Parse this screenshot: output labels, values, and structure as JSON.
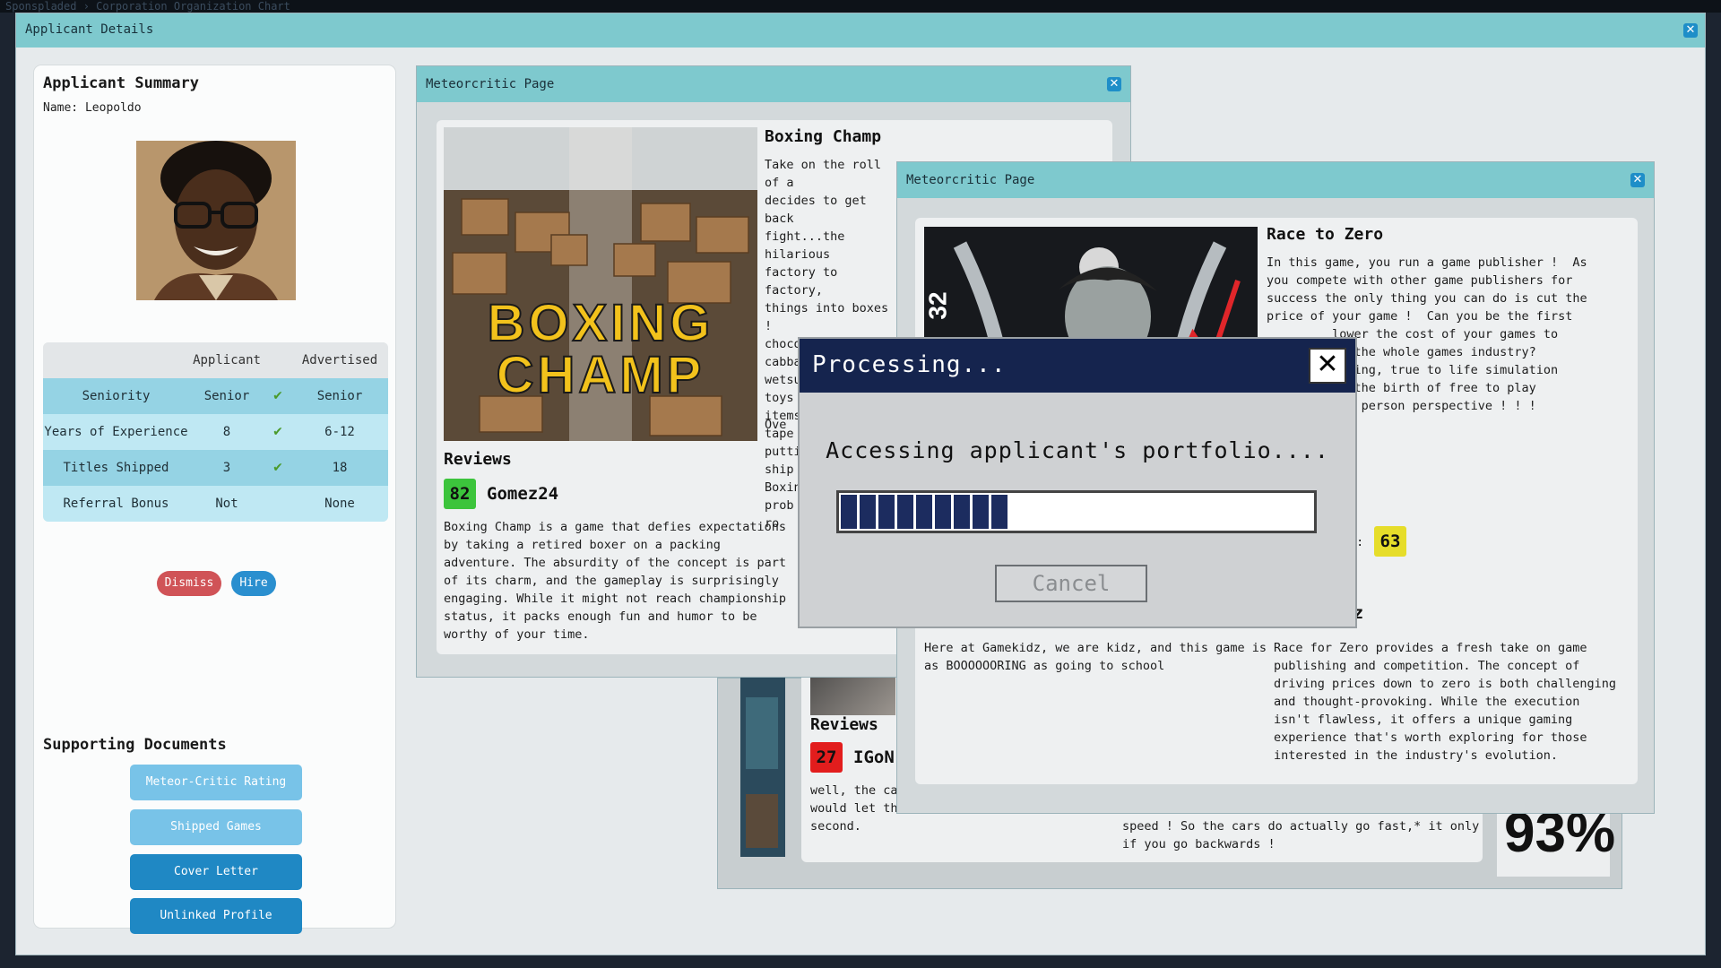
{
  "top_strip": {
    "text": "Sponspladed › Corporation Organization Chart"
  },
  "main_window": {
    "title": "Applicant Details"
  },
  "applicant": {
    "summary_title": "Applicant Summary",
    "name_line": "Name: Leopoldo",
    "table": {
      "headers": [
        "",
        "Applicant",
        "",
        "Advertised"
      ],
      "rows": [
        {
          "label": "Seniority",
          "applicant": "Senior",
          "match": "✔",
          "advertised": "Senior"
        },
        {
          "label": "Years of Experience",
          "applicant": "8",
          "match": "✔",
          "advertised": "6-12"
        },
        {
          "label": "Titles Shipped",
          "applicant": "3",
          "match": "✔",
          "advertised": "18"
        },
        {
          "label": "Referral Bonus",
          "applicant": "Not Referred",
          "match": "",
          "advertised": "None"
        }
      ]
    },
    "dismiss_label": "Dismiss",
    "hire_label": "Hire"
  },
  "supporting_docs": {
    "title": "Supporting Documents",
    "buttons": [
      "Meteor-Critic Rating",
      "Shipped Games",
      "Cover Letter",
      "Unlinked Profile"
    ]
  },
  "meteocritic_1": {
    "title": "Meteorcritic Page",
    "game_title": "Boxing Champ",
    "cover_text": "BOXING\nCHAMP",
    "description": "Take on the roll of a\ndecides to get back\nfight...the hilarious\nfactory to factory,\nthings into boxes !\nchocolates, cabbage\nwetsuits, and toys !\nitems and then tape\nputting on the ship\nBoxing Champ is prob\nro",
    "overall_partial": "Ove",
    "reviews_heading": "Reviews",
    "review": {
      "score": "82",
      "reviewer": "Gomez24",
      "text": "Boxing Champ is a game that defies expectations\nby taking a retired boxer on a packing\nadventure. The absurdity of the concept is part\nof its charm, and the gameplay is surprisingly\nengaging. While it might not reach championship\nstatus, it packs enough fun and humor to be\nworthy of your time."
    }
  },
  "meteocritic_2": {
    "title": "Meteorcritic Page",
    "game_title": "Race to Zero",
    "cover_number": "32",
    "description": "In this game, you run a game publisher !  As\nyou compete with other game publishers for\nsuccess the only thing you can do is cut the\nprice of your game !  Can you be the first\n         lower the cost of your games to\n       troy the whole games industry?\n       exciting, true to life simulation\n       ence the birth of free to play\n       first person perspective ! ! !",
    "rating_partial": "g:",
    "rating_score": "63",
    "reviewer_partial": "oGomerz",
    "review_left": "Here at Gamekidz, we are kidz, and this game is\nas BOOOOOORING as going to school",
    "review_right": "Race for Zero provides a fresh take on game\npublishing and competition. The concept of\ndriving prices down to zero is both challenging\nand thought-provoking. While the execution\nisn't flawless, it offers a unique gaming\nexperience that's worth exploring for those\ninterested in the industry's evolution."
  },
  "meteocritic_3": {
    "reviews_heading": "Reviews",
    "score": "27",
    "reviewer_partial": "IGoN",
    "review_text": "well, the car\nwould let them\nsecond.",
    "review_text_right": "speed ! So the cars do actually go fast,* it only\nif you go backwards !"
  },
  "bottom_percent": {
    "text": "93%"
  },
  "processing": {
    "title": "Processing...",
    "message": "Accessing applicant's portfolio....",
    "progress": 0.34,
    "cancel_label": "Cancel"
  },
  "colors": {
    "title_bar": "#7ec9ce",
    "dialog_title": "#15244e",
    "score_green": "#3cc43c",
    "score_yellow": "#e6dd2a",
    "score_red": "#e21d1d",
    "dismiss": "#d05357",
    "hire": "#2a8fcf"
  }
}
